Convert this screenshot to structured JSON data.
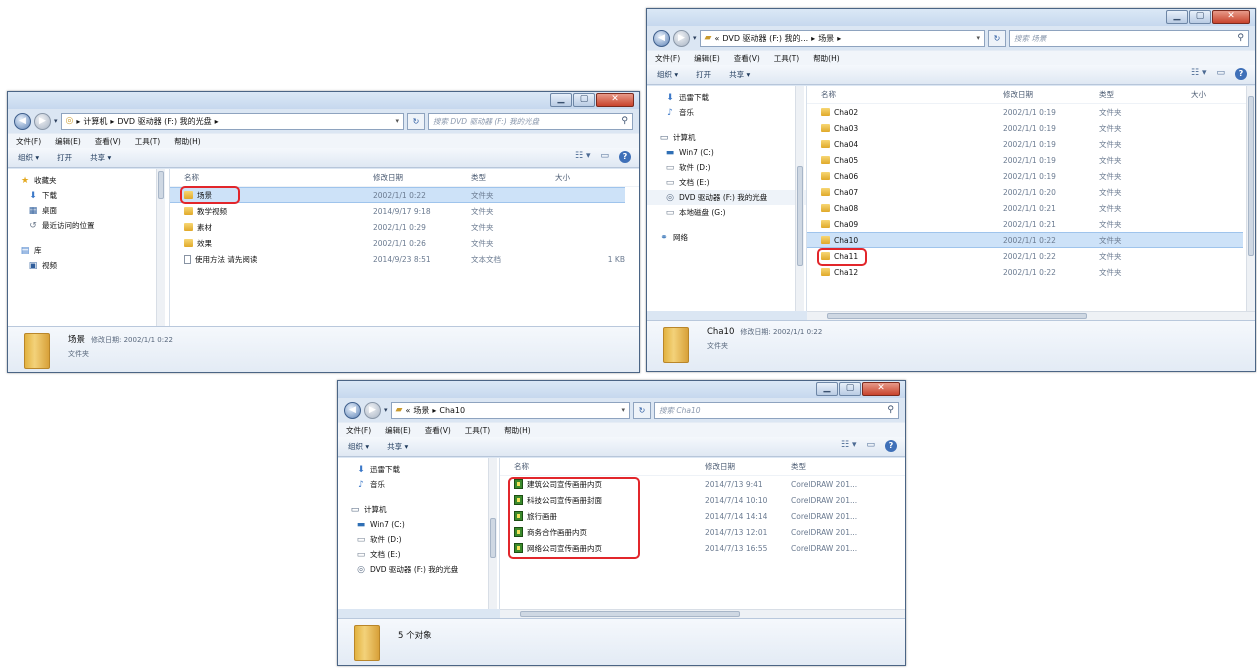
{
  "window1": {
    "address": [
      "计算机",
      "DVD 驱动器 (F:) 我的光盘"
    ],
    "search_placeholder": "搜索 DVD 驱动器 (F:) 我的光盘",
    "menu": [
      "文件(F)",
      "编辑(E)",
      "查看(V)",
      "工具(T)",
      "帮助(H)"
    ],
    "commands": [
      "组织 ▾",
      "打开",
      "共享 ▾"
    ],
    "nav": [
      {
        "icon": "★",
        "label": "收藏夹"
      },
      {
        "icon": "⬇",
        "label": "下载"
      },
      {
        "icon": "▦",
        "label": "桌面"
      },
      {
        "icon": "↺",
        "label": "最近访问的位置"
      },
      {
        "icon": "▤",
        "label": "库"
      },
      {
        "icon": "▣",
        "label": "视频"
      }
    ],
    "columns": {
      "name": "名称",
      "date": "修改日期",
      "type": "类型",
      "size": "大小"
    },
    "files": [
      {
        "name": "场景",
        "date": "2002/1/1 0:22",
        "type": "文件夹",
        "size": "",
        "kind": "folder"
      },
      {
        "name": "教学视频",
        "date": "2014/9/17 9:18",
        "type": "文件夹",
        "size": "",
        "kind": "folder"
      },
      {
        "name": "素材",
        "date": "2002/1/1 0:29",
        "type": "文件夹",
        "size": "",
        "kind": "folder"
      },
      {
        "name": "效果",
        "date": "2002/1/1 0:26",
        "type": "文件夹",
        "size": "",
        "kind": "folder"
      },
      {
        "name": "使用方法 请先阅读",
        "date": "2014/9/23 8:51",
        "type": "文本文档",
        "size": "1 KB",
        "kind": "txt"
      }
    ],
    "details": {
      "name": "场景",
      "meta": "修改日期: 2002/1/1 0:22",
      "type": "文件夹"
    }
  },
  "window2": {
    "address": [
      "DVD 驱动器 (F:) 我的...",
      "场景"
    ],
    "search_placeholder": "搜索 场景",
    "menu": [
      "文件(F)",
      "编辑(E)",
      "查看(V)",
      "工具(T)",
      "帮助(H)"
    ],
    "commands": [
      "组织 ▾",
      "打开",
      "共享 ▾"
    ],
    "nav": [
      {
        "icon": "⬇",
        "label": "迅雷下载"
      },
      {
        "icon": "♪",
        "label": "音乐"
      },
      {
        "icon": "",
        "label": ""
      },
      {
        "icon": "▭",
        "label": "计算机"
      },
      {
        "icon": "▬",
        "label": "Win7 (C:)"
      },
      {
        "icon": "▭",
        "label": "软件 (D:)"
      },
      {
        "icon": "▭",
        "label": "文档 (E:)"
      },
      {
        "icon": "◎",
        "label": "DVD 驱动器 (F:) 我的光盘"
      },
      {
        "icon": "▭",
        "label": "本地磁盘 (G:)"
      },
      {
        "icon": "",
        "label": ""
      },
      {
        "icon": "⚭",
        "label": "网络"
      }
    ],
    "columns": {
      "name": "名称",
      "date": "修改日期",
      "type": "类型",
      "size": "大小"
    },
    "files": [
      {
        "name": "Cha02",
        "date": "2002/1/1 0:19",
        "type": "文件夹"
      },
      {
        "name": "Cha03",
        "date": "2002/1/1 0:19",
        "type": "文件夹"
      },
      {
        "name": "Cha04",
        "date": "2002/1/1 0:19",
        "type": "文件夹"
      },
      {
        "name": "Cha05",
        "date": "2002/1/1 0:19",
        "type": "文件夹"
      },
      {
        "name": "Cha06",
        "date": "2002/1/1 0:19",
        "type": "文件夹"
      },
      {
        "name": "Cha07",
        "date": "2002/1/1 0:20",
        "type": "文件夹"
      },
      {
        "name": "Cha08",
        "date": "2002/1/1 0:21",
        "type": "文件夹"
      },
      {
        "name": "Cha09",
        "date": "2002/1/1 0:21",
        "type": "文件夹"
      },
      {
        "name": "Cha10",
        "date": "2002/1/1 0:22",
        "type": "文件夹"
      },
      {
        "name": "Cha11",
        "date": "2002/1/1 0:22",
        "type": "文件夹"
      },
      {
        "name": "Cha12",
        "date": "2002/1/1 0:22",
        "type": "文件夹"
      }
    ],
    "details": {
      "name": "Cha10",
      "meta": "修改日期: 2002/1/1 0:22",
      "type": "文件夹"
    }
  },
  "window3": {
    "address": [
      "场景",
      "Cha10"
    ],
    "search_placeholder": "搜索 Cha10",
    "menu": [
      "文件(F)",
      "编辑(E)",
      "查看(V)",
      "工具(T)",
      "帮助(H)"
    ],
    "commands": [
      "组织 ▾",
      "共享 ▾"
    ],
    "nav": [
      {
        "icon": "⬇",
        "label": "迅雷下载"
      },
      {
        "icon": "♪",
        "label": "音乐"
      },
      {
        "icon": "",
        "label": ""
      },
      {
        "icon": "▭",
        "label": "计算机"
      },
      {
        "icon": "▬",
        "label": "Win7 (C:)"
      },
      {
        "icon": "▭",
        "label": "软件 (D:)"
      },
      {
        "icon": "▭",
        "label": "文档 (E:)"
      },
      {
        "icon": "◎",
        "label": "DVD 驱动器 (F:) 我的光盘"
      }
    ],
    "columns": {
      "name": "名称",
      "date": "修改日期",
      "type": "类型"
    },
    "files": [
      {
        "name": "建筑公司宣传画册内页",
        "date": "2014/7/13 9:41",
        "type": "CorelDRAW 201..."
      },
      {
        "name": "科技公司宣传画册封面",
        "date": "2014/7/14 10:10",
        "type": "CorelDRAW 201..."
      },
      {
        "name": "旅行画册",
        "date": "2014/7/14 14:14",
        "type": "CorelDRAW 201..."
      },
      {
        "name": "商务合作画册内页",
        "date": "2014/7/13 12:01",
        "type": "CorelDRAW 201..."
      },
      {
        "name": "网络公司宣传画册内页",
        "date": "2014/7/13 16:55",
        "type": "CorelDRAW 201..."
      }
    ],
    "details": {
      "count": "5 个对象"
    }
  }
}
